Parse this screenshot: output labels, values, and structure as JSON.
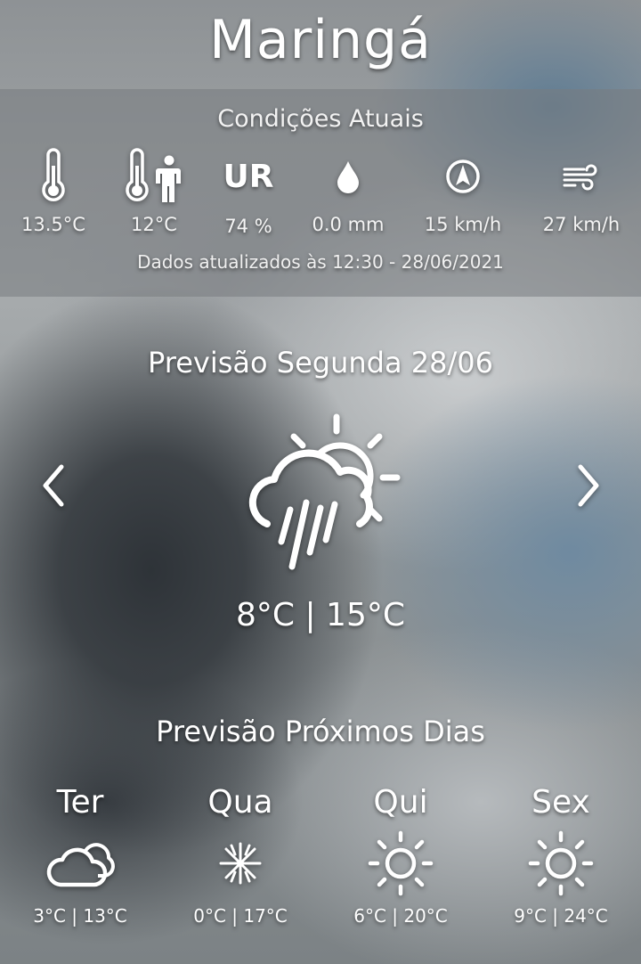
{
  "city": "Maringá",
  "current": {
    "heading": "Condições Atuais",
    "metrics": [
      {
        "icon": "thermometer-icon",
        "value": "13.5°C"
      },
      {
        "icon": "feels-like-icon",
        "value": "12°C"
      },
      {
        "icon": "humidity-icon",
        "label": "UR",
        "value": "74 %"
      },
      {
        "icon": "rain-drop-icon",
        "value": "0.0 mm"
      },
      {
        "icon": "wind-direction-icon",
        "value": "15 km/h"
      },
      {
        "icon": "wind-gust-icon",
        "value": "27 km/h"
      }
    ],
    "updated": "Dados atualizados às 12:30 - 28/06/2021"
  },
  "today": {
    "heading": "Previsão Segunda 28/06",
    "icon": "sun-cloud-rain-icon",
    "temps": "8°C | 15°C"
  },
  "next": {
    "heading": "Previsão Próximos Dias",
    "days": [
      {
        "name": "Ter",
        "icon": "cloudy-icon",
        "temps": "3°C | 13°C"
      },
      {
        "name": "Qua",
        "icon": "frost-icon",
        "temps": "0°C | 17°C"
      },
      {
        "name": "Qui",
        "icon": "sun-icon",
        "temps": "6°C | 20°C"
      },
      {
        "name": "Sex",
        "icon": "sun-icon",
        "temps": "9°C | 24°C"
      }
    ]
  }
}
